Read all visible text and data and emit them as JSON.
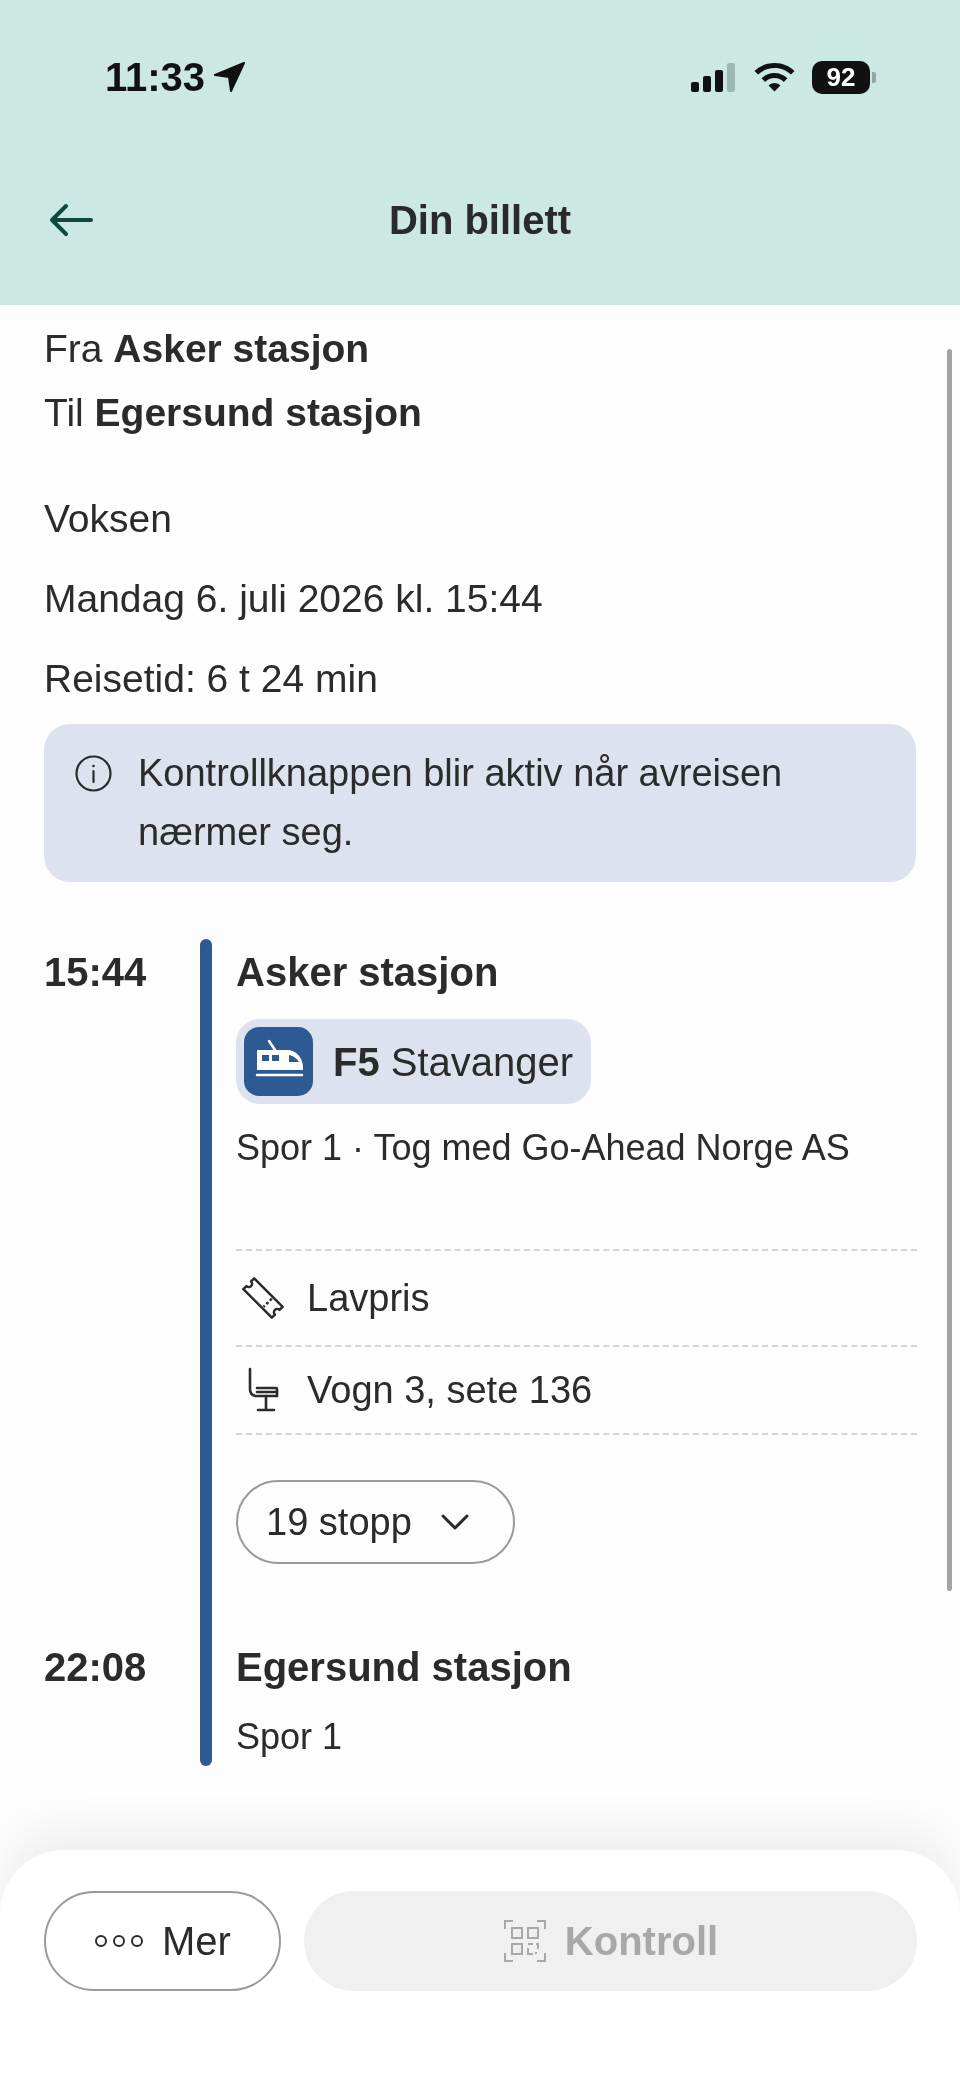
{
  "status_bar": {
    "time": "11:33",
    "battery": "92"
  },
  "header": {
    "title": "Din billett"
  },
  "route": [
    "Fra **Asker stasjon**",
    "Til **Egersund stasjon**"
  ],
  "details": [
    "Voksen",
    "Mandag 6. juli 2026 kl. 15:44",
    "Reisetid: 6 t 24 min"
  ],
  "info_notice": "Kontrollknappen blir aktiv når avreisen nærmer seg.",
  "journey": {
    "departure": {
      "time": "15:44",
      "station": "Asker stasjon"
    },
    "line": "**F5** Stavanger",
    "track_operator": "Spor 1 · Tog med Go-Ahead Norge AS",
    "ticket_rows": [
      {
        "kind": "fare",
        "text": "Lavpris"
      },
      {
        "kind": "seat",
        "text": "Vogn 3, sete 136"
      }
    ],
    "stops_button": {
      "label": "19 stopp",
      "expanded": false
    },
    "arrival": {
      "time": "22:08",
      "station": "Egersund stasjon",
      "track": "Spor 1"
    }
  },
  "actions": [
    {
      "kind": "more",
      "label": "Mer",
      "disabled": false
    },
    {
      "kind": "control",
      "label": "Kontroll",
      "disabled": true
    }
  ]
}
